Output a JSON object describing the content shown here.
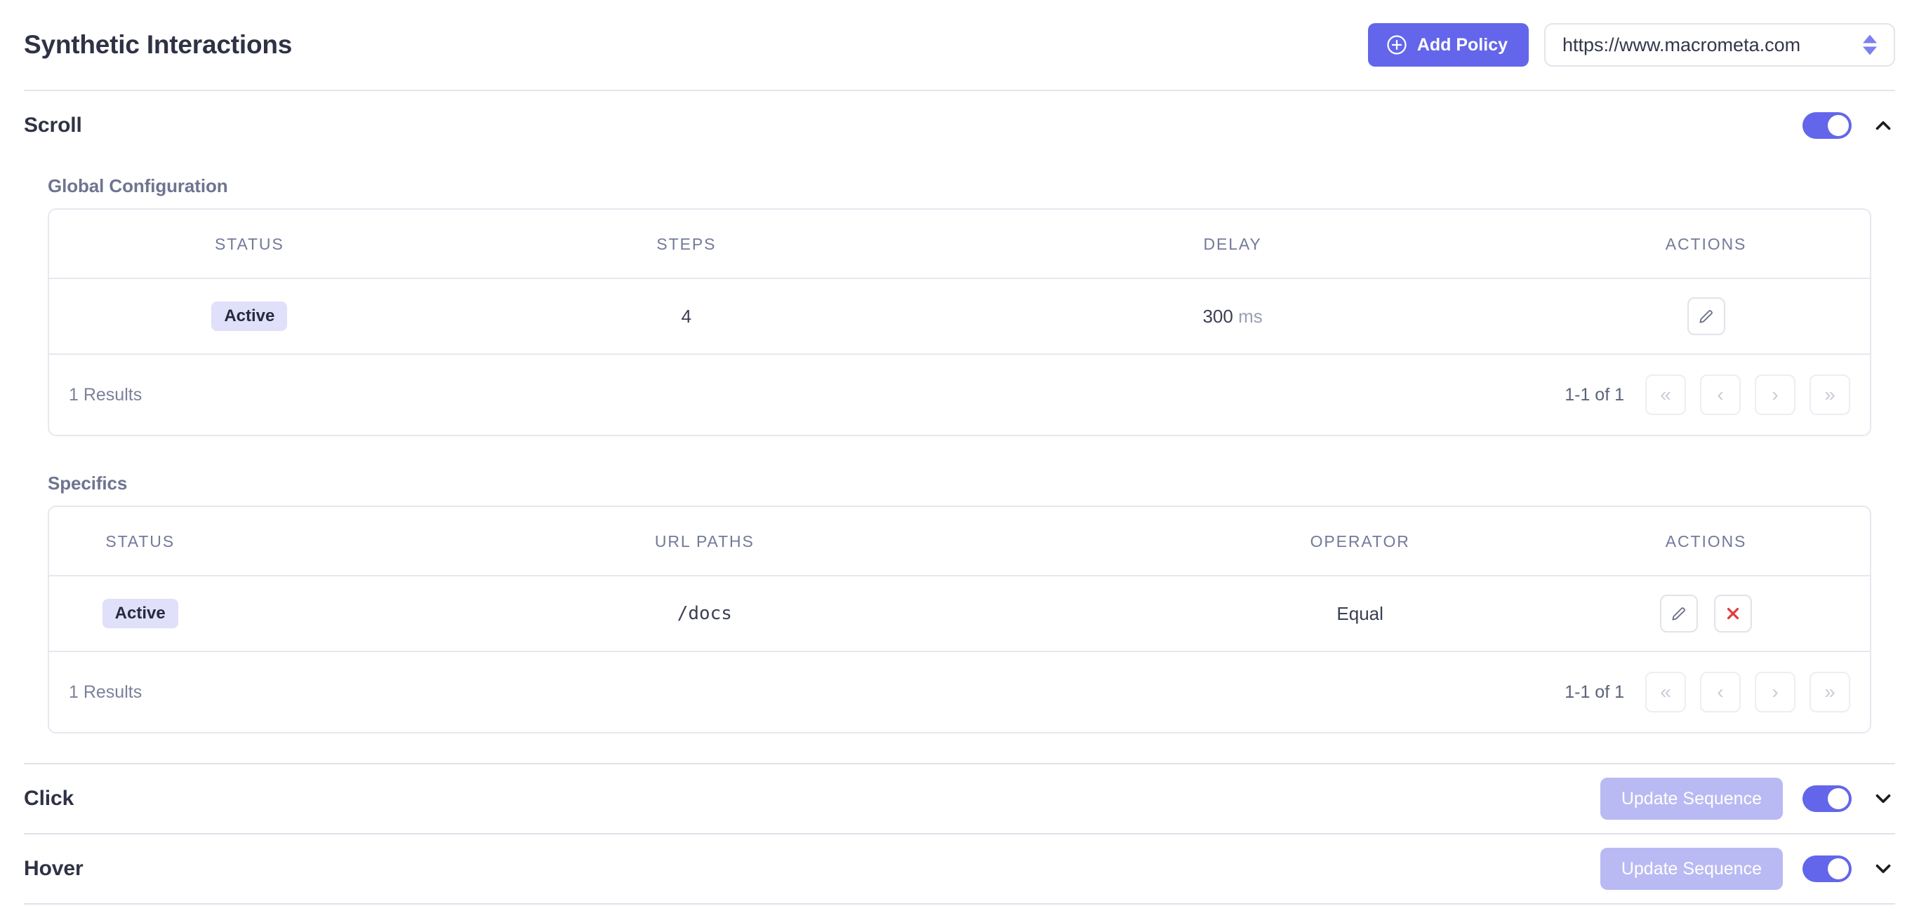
{
  "header": {
    "title": "Synthetic Interactions",
    "add_policy_label": "Add Policy",
    "add_policy_icon": "plus-circle-icon",
    "site_select_value": "https://www.macrometa.com"
  },
  "sections": [
    {
      "title": "Scroll",
      "toggle_on": true,
      "expanded": true,
      "chevron": "chevron-up-icon",
      "global_configuration": {
        "label": "Global Configuration",
        "columns": [
          "STATUS",
          "STEPS",
          "DELAY",
          "ACTIONS"
        ],
        "rows": [
          {
            "status": "Active",
            "steps": "4",
            "delay_value": "300",
            "delay_unit": "ms",
            "actions": [
              "edit-icon"
            ]
          }
        ],
        "footer": {
          "results": "1 Results",
          "range": "1-1 of 1",
          "pager": [
            "first-page-icon",
            "previous-page-icon",
            "next-page-icon",
            "last-page-icon"
          ]
        }
      },
      "specifics": {
        "label": "Specifics",
        "columns": [
          "STATUS",
          "URL PATHS",
          "OPERATOR",
          "ACTIONS"
        ],
        "rows": [
          {
            "status": "Active",
            "url_path": "/docs",
            "operator": "Equal",
            "actions": [
              "edit-icon",
              "delete-icon"
            ]
          }
        ],
        "footer": {
          "results": "1 Results",
          "range": "1-1 of 1",
          "pager": [
            "first-page-icon",
            "previous-page-icon",
            "next-page-icon",
            "last-page-icon"
          ]
        }
      }
    },
    {
      "title": "Click",
      "update_sequence_label": "Update Sequence",
      "toggle_on": true,
      "expanded": false,
      "chevron": "chevron-down-icon"
    },
    {
      "title": "Hover",
      "update_sequence_label": "Update Sequence",
      "toggle_on": true,
      "expanded": false,
      "chevron": "chevron-down-icon"
    }
  ],
  "colors": {
    "accent": "#6366ea",
    "accent_muted": "#b9baf3",
    "badge_bg": "#e0e0fa",
    "danger": "#e03c3c",
    "border": "#e7e8ef"
  }
}
